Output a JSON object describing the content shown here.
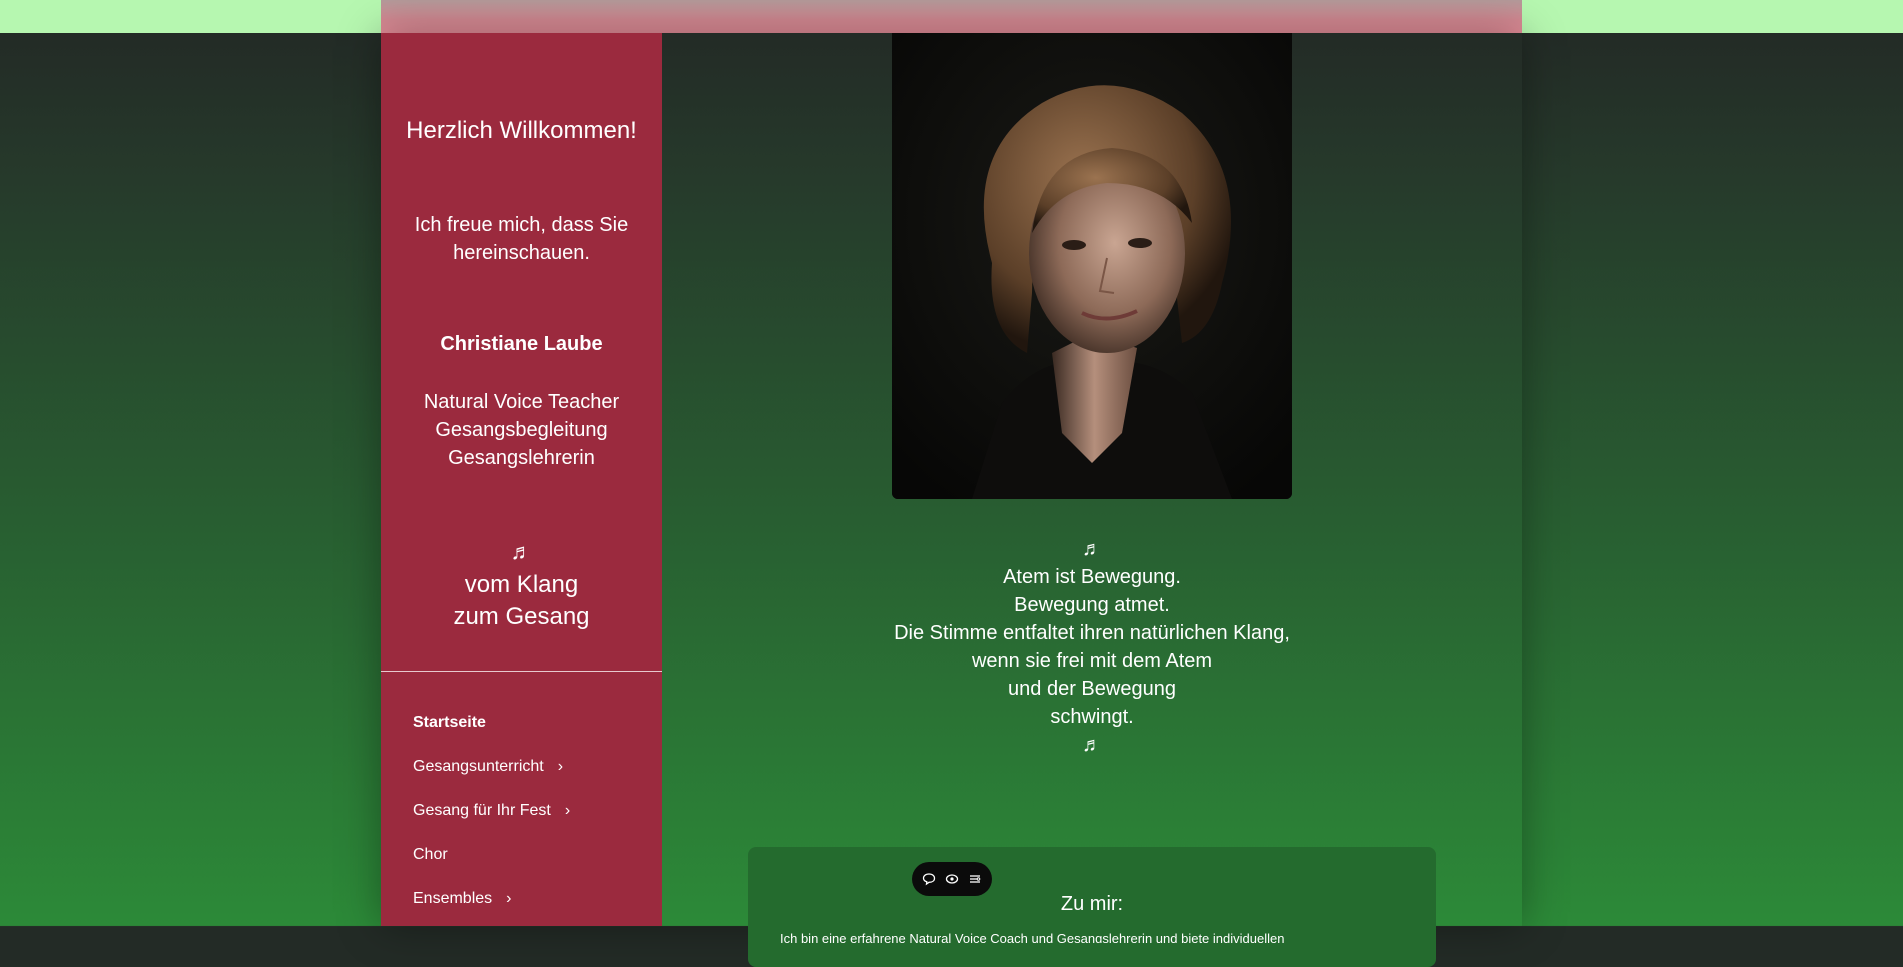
{
  "sidebar": {
    "greeting": "Herzlich Willkommen!",
    "welcome_line1": "Ich freue mich, dass Sie",
    "welcome_line2": "hereinschauen.",
    "name": "Christiane Laube",
    "roles": [
      "Natural Voice Teacher",
      "Gesangsbegleitung",
      "Gesangslehrerin"
    ],
    "note_symbol": "♬",
    "motto_line1": "vom Klang",
    "motto_line2": "zum Gesang",
    "nav": [
      {
        "label": "Startseite",
        "active": true,
        "has_children": false
      },
      {
        "label": "Gesangsunterricht",
        "active": false,
        "has_children": true
      },
      {
        "label": "Gesang für Ihr Fest",
        "active": false,
        "has_children": true
      },
      {
        "label": "Chor",
        "active": false,
        "has_children": false
      },
      {
        "label": "Ensembles",
        "active": false,
        "has_children": true
      }
    ],
    "chevron": "›"
  },
  "main": {
    "poem": {
      "note_top": "♬",
      "lines": [
        "Atem ist Bewegung.",
        "Bewegung atmet.",
        "Die Stimme entfaltet ihren natürlichen Klang,",
        "wenn sie frei mit dem Atem",
        "und der Bewegung",
        "schwingt."
      ],
      "note_bottom": "♬"
    },
    "about": {
      "title": "Zu mir:",
      "text": "Ich bin eine erfahrene Natural Voice Coach und Gesangslehrerin und biete individuellen"
    }
  },
  "floating_toolbar": {
    "icons": [
      "comment-icon",
      "eye-icon",
      "list-settings-icon"
    ]
  },
  "colors": {
    "sidebar_bg": "#9b2a3e",
    "top_strip": "#b6f7b0",
    "page_gradient_bottom": "#2c8a38",
    "box_bg": "#246b2e"
  }
}
